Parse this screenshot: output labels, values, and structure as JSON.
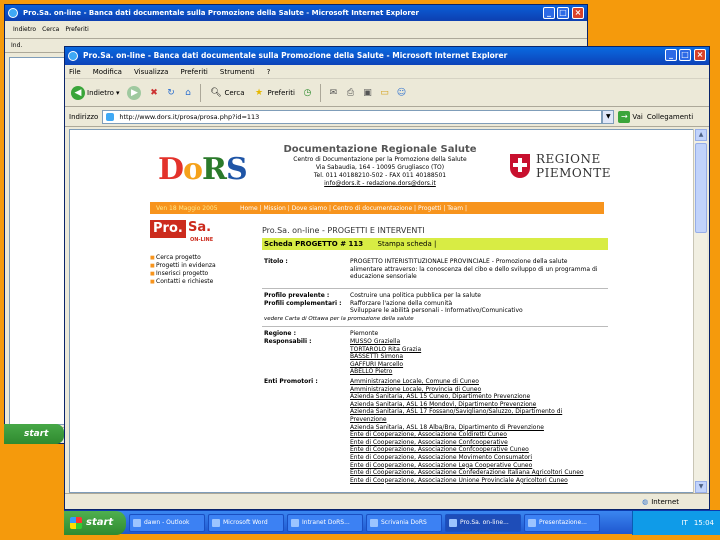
{
  "back_window": {
    "title": "Pro.Sa. on-line - Banca dati documentale sulla Promozione della Salute - Microsoft Internet Explorer",
    "back_label": "Indietro",
    "search_label": "Cerca",
    "favorites_label": "Preferiti",
    "address_label": "Ind.",
    "start_label": "start"
  },
  "front_window": {
    "title": "Pro.Sa. on-line - Banca dati documentale sulla Promozione della Salute - Microsoft Internet Explorer",
    "menu": [
      "File",
      "Modifica",
      "Visualizza",
      "Preferiti",
      "Strumenti",
      "?"
    ],
    "toolbar": {
      "back": "Indietro",
      "search": "Cerca",
      "favorites": "Preferiti"
    },
    "address_label": "Indirizzo",
    "address_value": "http://www.dors.it/prosa/prosa.php?id=113",
    "go_label": "Vai",
    "links_label": "Collegamenti",
    "status_text": "Internet"
  },
  "page": {
    "header_title": "Documentazione Regionale Salute",
    "header_lines": [
      "Centro di Documentazione per la Promozione della Salute",
      "Via Sabaudia, 164 - 10095 Grugliasco (TO)",
      "Tel. 011 40188210-502 - FAX 011 40188501",
      "info@dors.it - redazione.dors@dors.it"
    ],
    "regione_line1": "REGIONE",
    "regione_line2": "PIEMONTE",
    "logo_letters": [
      "D",
      "o",
      "R",
      "S"
    ],
    "nav_date": "Ven 18 Maggio 2005",
    "nav_links": "Home | Mission | Dove siamo | Centro di documentazione | Progetti | Team |",
    "prosa_pro": "Pro.",
    "prosa_sa": "Sa.",
    "prosa_online": "ON-LINE",
    "left_menu": [
      "Cerca progetto",
      "Progetti in evidenza",
      "Inserisci progetto",
      "Contatti e richieste"
    ],
    "heading": "Pro.Sa. on-line - PROGETTI E INTERVENTI",
    "scheda_label": "Scheda PROGETTO # 113",
    "stampa_label": "Stampa scheda |",
    "fields": {
      "titolo_label": "Titolo :",
      "titolo_value": "PROGETTO INTERISTITUZIONALE PROVINCIALE - Promozione della salute alimentare attraverso: la conoscenza del cibo e dello sviluppo di un programma di educazione sensoriale",
      "profilo_prev_label": "Profilo prevalente :",
      "profilo_prev_value": "Costruire una politica pubblica per la salute",
      "profili_comp_label": "Profili complementari :",
      "profili_comp_value_1": "Rafforzare l'azione della comunità",
      "profili_comp_value_2": "Sviluppare le abilità personali - Informativo/Comunicativo",
      "note": "vedere Carta di Ottawa per la promozione della salute",
      "regione_label": "Regione :",
      "regione_value": "Piemonte",
      "responsabili_label": "Responsabili :",
      "responsabili": [
        "MUSSO Graziella",
        "TORTAROLO Rita Grazia",
        "BASSETTI Simona",
        "GAFFURI Marcello",
        "ABELLO Pietro"
      ],
      "enti_label": "Enti Promotori :",
      "enti": [
        "Amministrazione Locale, Comune di Cuneo",
        "Amministrazione Locale, Provincia di Cuneo",
        "Azienda Sanitaria, ASL 15 Cuneo, Dipartimento Prevenzione",
        "Azienda Sanitaria, ASL 16 Mondovì, Dipartimento Prevenzione",
        "Azienda Sanitaria, ASL 17 Fossano/Savigliano/Saluzzo, Dipartimento di Prevenzione",
        "Azienda Sanitaria, ASL 18 Alba/Bra, Dipartimento di Prevenzione",
        "Ente di Cooperazione, Associazione Coldiretti Cuneo",
        "Ente di Cooperazione, Associazione Confcooperative",
        "Ente di Cooperazione, Associazione Confcooperative Cuneo",
        "Ente di Cooperazione, Associazione Movimento Consumatori",
        "Ente di Cooperazione, Associazione Lega Cooperative Cuneo",
        "Ente di Cooperazione, Associazione Confederazione Italiana Agricoltori Cuneo",
        "Ente di Cooperazione, Associazione Unione Provinciale Agricoltori Cuneo"
      ]
    }
  },
  "taskbar": {
    "start_label": "start",
    "items": [
      "dawn - Outlook",
      "Microsoft Word",
      "Intranet DoRS...",
      "Scrivania DoRS",
      "Pro.Sa. on-line...",
      "Presentazione..."
    ],
    "tray_lang": "IT",
    "clock": "15:04"
  },
  "colors": {
    "desktop": "#f59a0c",
    "nav_orange": "#f7941d",
    "scheda_green": "#d8ec44",
    "prosa_red": "#cc2b1d"
  }
}
